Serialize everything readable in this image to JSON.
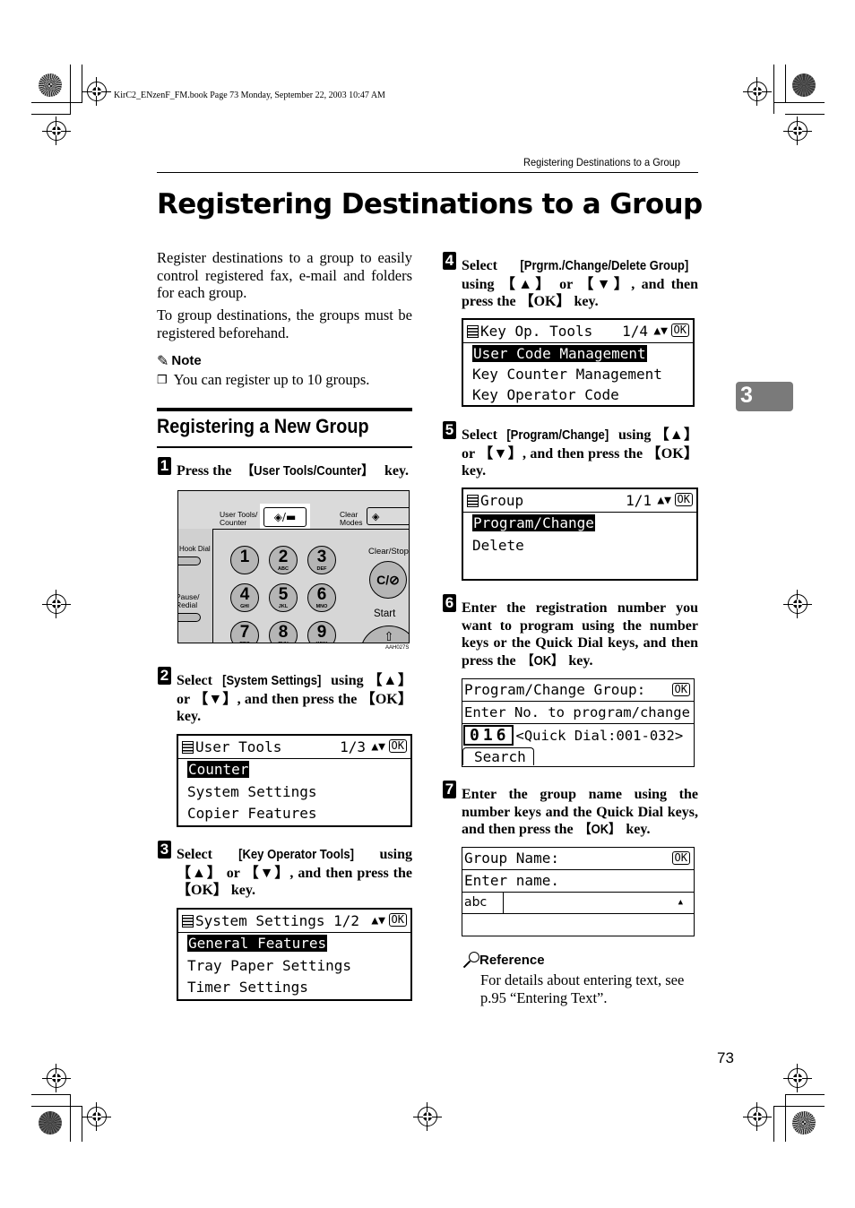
{
  "file_info": "KirC2_ENzenF_FM.book  Page 73  Monday, September 22, 2003  10:47 AM",
  "running_head": "Registering Destinations to a Group",
  "page_title": "Registering Destinations to a Group",
  "intro": {
    "para1": "Register destinations to a group to easily control registered fax, e-mail and folders for each group.",
    "para2": "To group destinations, the groups must be registered beforehand."
  },
  "note": {
    "icon": "pencil-icon",
    "heading": "Note",
    "items": [
      "You can register up to 10 groups."
    ]
  },
  "section_title": "Registering a New Group",
  "steps": [
    {
      "num": "1",
      "pre": "Press the ",
      "key": "【User Tools/Counter】",
      "post": " key."
    },
    {
      "num": "2",
      "pre": "Select ",
      "key": "[System Settings]",
      "post": " using 【▲】 or 【▼】, and then press the 【OK】 key."
    },
    {
      "num": "3",
      "pre": "Select ",
      "key": "[Key Operator Tools]",
      "post": " using 【▲】 or 【▼】, and then press the 【OK】 key."
    },
    {
      "num": "4",
      "pre": "Select ",
      "key": "[Prgrm./Change/Delete Group]",
      "post": " using 【▲】 or 【▼】, and then press the 【OK】 key."
    },
    {
      "num": "5",
      "pre": "Select ",
      "key": "[Program/Change]",
      "post": " using 【▲】 or 【▼】, and then press the 【OK】 key."
    },
    {
      "num": "6",
      "pre": "Enter the registration number you want to program using the number keys or the Quick Dial keys, and then press the ",
      "key": "【OK】",
      "post": " key."
    },
    {
      "num": "7",
      "pre": "Enter the group name using the number keys and the Quick Dial keys, and then press the ",
      "key": "【OK】",
      "post": " key."
    }
  ],
  "panel": {
    "user_tools_label": "User Tools/ Counter",
    "clear_modes_label": "Clear Modes",
    "hook_dial_label": "Hook Dial",
    "pause_redial_label": "Pause/ Redial",
    "clear_stop_label": "Clear/Stop",
    "clear_stop_key": "C/⊘",
    "start_label": "Start",
    "figure_code": "AAH027S",
    "keys": [
      {
        "digit": "1",
        "letters": ""
      },
      {
        "digit": "2",
        "letters": "ABC"
      },
      {
        "digit": "3",
        "letters": "DEF"
      },
      {
        "digit": "4",
        "letters": "GHI"
      },
      {
        "digit": "5",
        "letters": "JKL"
      },
      {
        "digit": "6",
        "letters": "MNO"
      },
      {
        "digit": "7",
        "letters": "PRS"
      },
      {
        "digit": "8",
        "letters": "TUV"
      },
      {
        "digit": "9",
        "letters": "WXY"
      }
    ]
  },
  "screens": {
    "user_tools": {
      "title": "User Tools",
      "page": "1/3",
      "ok": "OK",
      "rows": [
        "Counter",
        "System Settings",
        "Copier Features"
      ],
      "selected": 0
    },
    "system_settings": {
      "title": "System Settings",
      "page": "1/2",
      "ok": "OK",
      "rows": [
        "General Features",
        "Tray Paper Settings",
        "Timer Settings"
      ],
      "selected": 0
    },
    "key_op_tools": {
      "title": "Key Op. Tools",
      "page": "1/4",
      "ok": "OK",
      "rows": [
        "User Code Management",
        "Key Counter Management",
        "Key Operator Code"
      ],
      "selected": 0
    },
    "group": {
      "title": "Group",
      "page": "1/1",
      "ok": "OK",
      "rows": [
        "Program/Change",
        "Delete",
        ""
      ],
      "selected": 0
    },
    "program_change_group": {
      "title": "Program/Change Group:",
      "ok": "OK",
      "prompt": "Enter No. to program/change",
      "number": "016",
      "range": "<Quick Dial:001-032>",
      "search_button": "Search"
    },
    "group_name": {
      "title": "Group Name:",
      "ok": "OK",
      "prompt": "Enter name.",
      "mode": "abc",
      "cursor_indicator": "▲"
    }
  },
  "reference": {
    "icon": "magnifier-icon",
    "heading": "Reference",
    "text": "For details about entering text, see p.95 “Entering Text”."
  },
  "chapter_tab": "3",
  "page_number": "73"
}
